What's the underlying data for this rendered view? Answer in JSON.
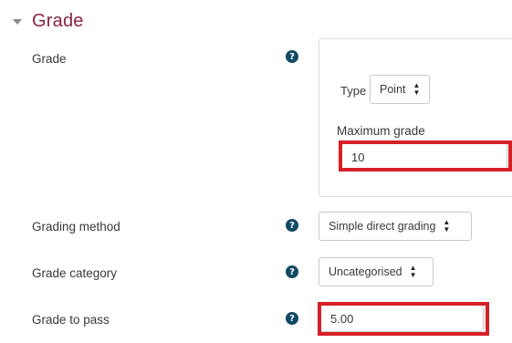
{
  "section": {
    "title": "Grade"
  },
  "grade_row": {
    "label": "Grade",
    "help_icon": "?",
    "type_label": "Type",
    "type_value": "Point",
    "max_grade_label": "Maximum grade",
    "max_grade_value": "10"
  },
  "grading_method": {
    "label": "Grading method",
    "help_icon": "?",
    "value": "Simple direct grading"
  },
  "grade_category": {
    "label": "Grade category",
    "help_icon": "?",
    "value": "Uncategorised"
  },
  "grade_to_pass": {
    "label": "Grade to pass",
    "help_icon": "?",
    "value": "5.00"
  },
  "colors": {
    "section_title": "#8b2245",
    "help_icon": "#114a64",
    "highlight": "#d62027"
  }
}
